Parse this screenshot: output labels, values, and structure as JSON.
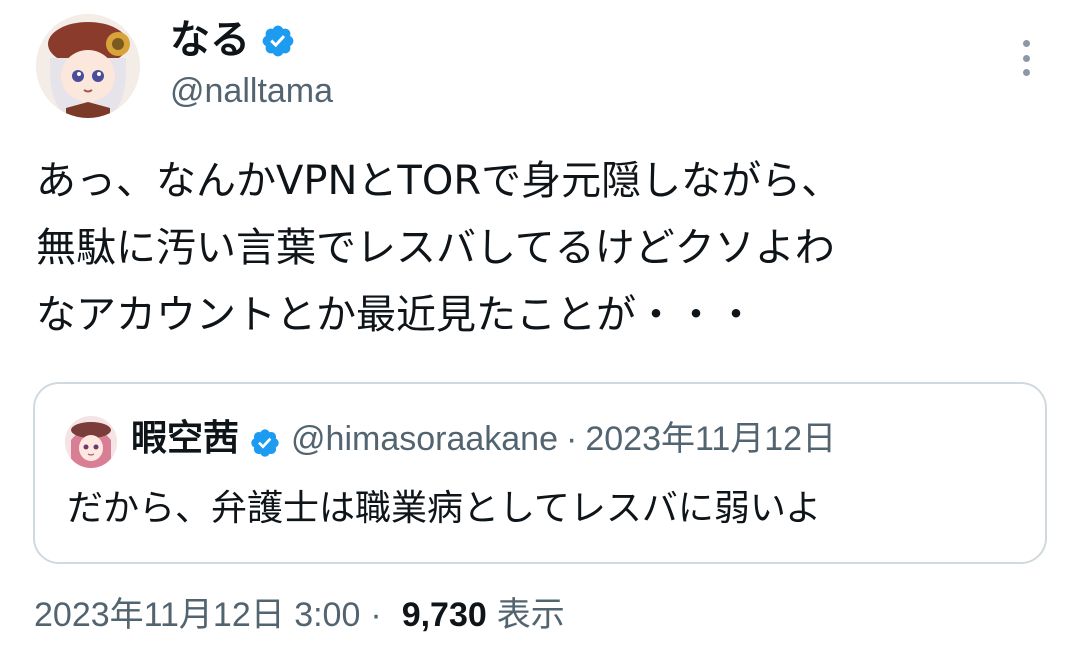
{
  "author": {
    "name": "なる",
    "handle": "@nalltama",
    "verified": true
  },
  "tweet": {
    "lines": [
      "あっ、なんかVPNとTORで身元隠しながら、",
      "無駄に汚い言葉でレスバしてるけどクソよわ",
      "なアカウントとか最近見たことが・・・"
    ]
  },
  "quote": {
    "name": "暇空茜",
    "handle": "@himasoraakane",
    "separator": "·",
    "date": "2023年11月12日",
    "text": "だから、弁護士は職業病としてレスバに弱いよ",
    "verified": true
  },
  "meta": {
    "timestamp": "2023年11月12日 3:00",
    "separator": "·",
    "views_count": "9,730",
    "views_label": "表示"
  },
  "colors": {
    "text_primary": "#0f1419",
    "text_secondary": "#536471",
    "verified_blue": "#1d9bf0",
    "border": "#cfd9de"
  },
  "icons": {
    "verified": "verified-badge-icon",
    "more": "more-vertical-icon"
  }
}
